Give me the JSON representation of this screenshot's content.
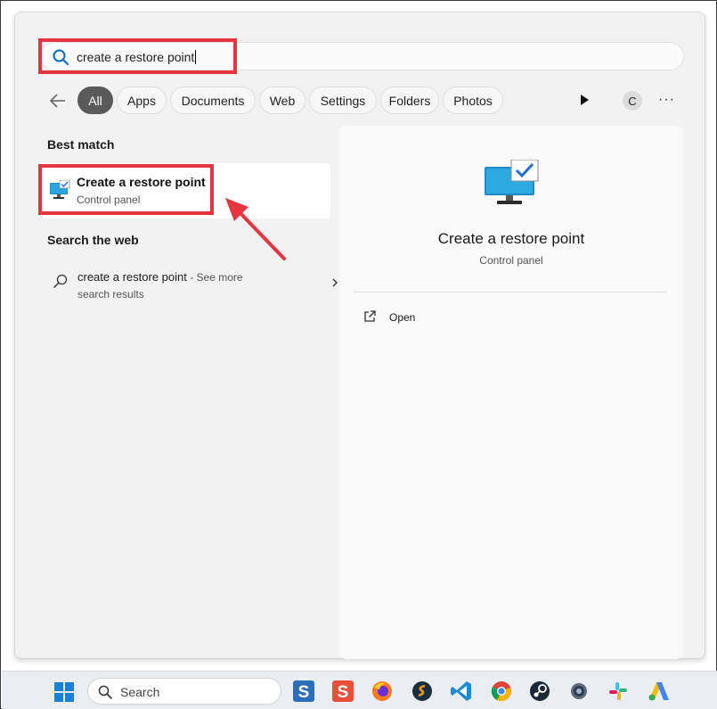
{
  "search": {
    "query": "create a restore point"
  },
  "filters": {
    "all": "All",
    "apps": "Apps",
    "documents": "Documents",
    "web": "Web",
    "settings": "Settings",
    "folders": "Folders",
    "photos": "Photos"
  },
  "account": {
    "initial": "C"
  },
  "more_label": "···",
  "best_match": {
    "heading": "Best match",
    "title": "Create a restore point",
    "subtitle": "Control panel",
    "icon": "monitor-check-icon"
  },
  "search_web": {
    "heading": "Search the web",
    "query": "create a restore point",
    "see_more": " - See more",
    "line2": "search results"
  },
  "preview": {
    "title": "Create a restore point",
    "subtitle": "Control panel",
    "action_open": "Open"
  },
  "taskbar": {
    "search_label": "Search",
    "apps": [
      "sticky-s-icon",
      "sheets-s-icon",
      "firefox-icon",
      "simplenote-icon",
      "vscode-icon",
      "chrome-icon",
      "steam-icon",
      "settings-icon",
      "slack-icon",
      "ads-icon"
    ]
  },
  "colors": {
    "highlight": "#e53540",
    "accent": "#0067c0",
    "chip_active": "#5a5a5a"
  }
}
